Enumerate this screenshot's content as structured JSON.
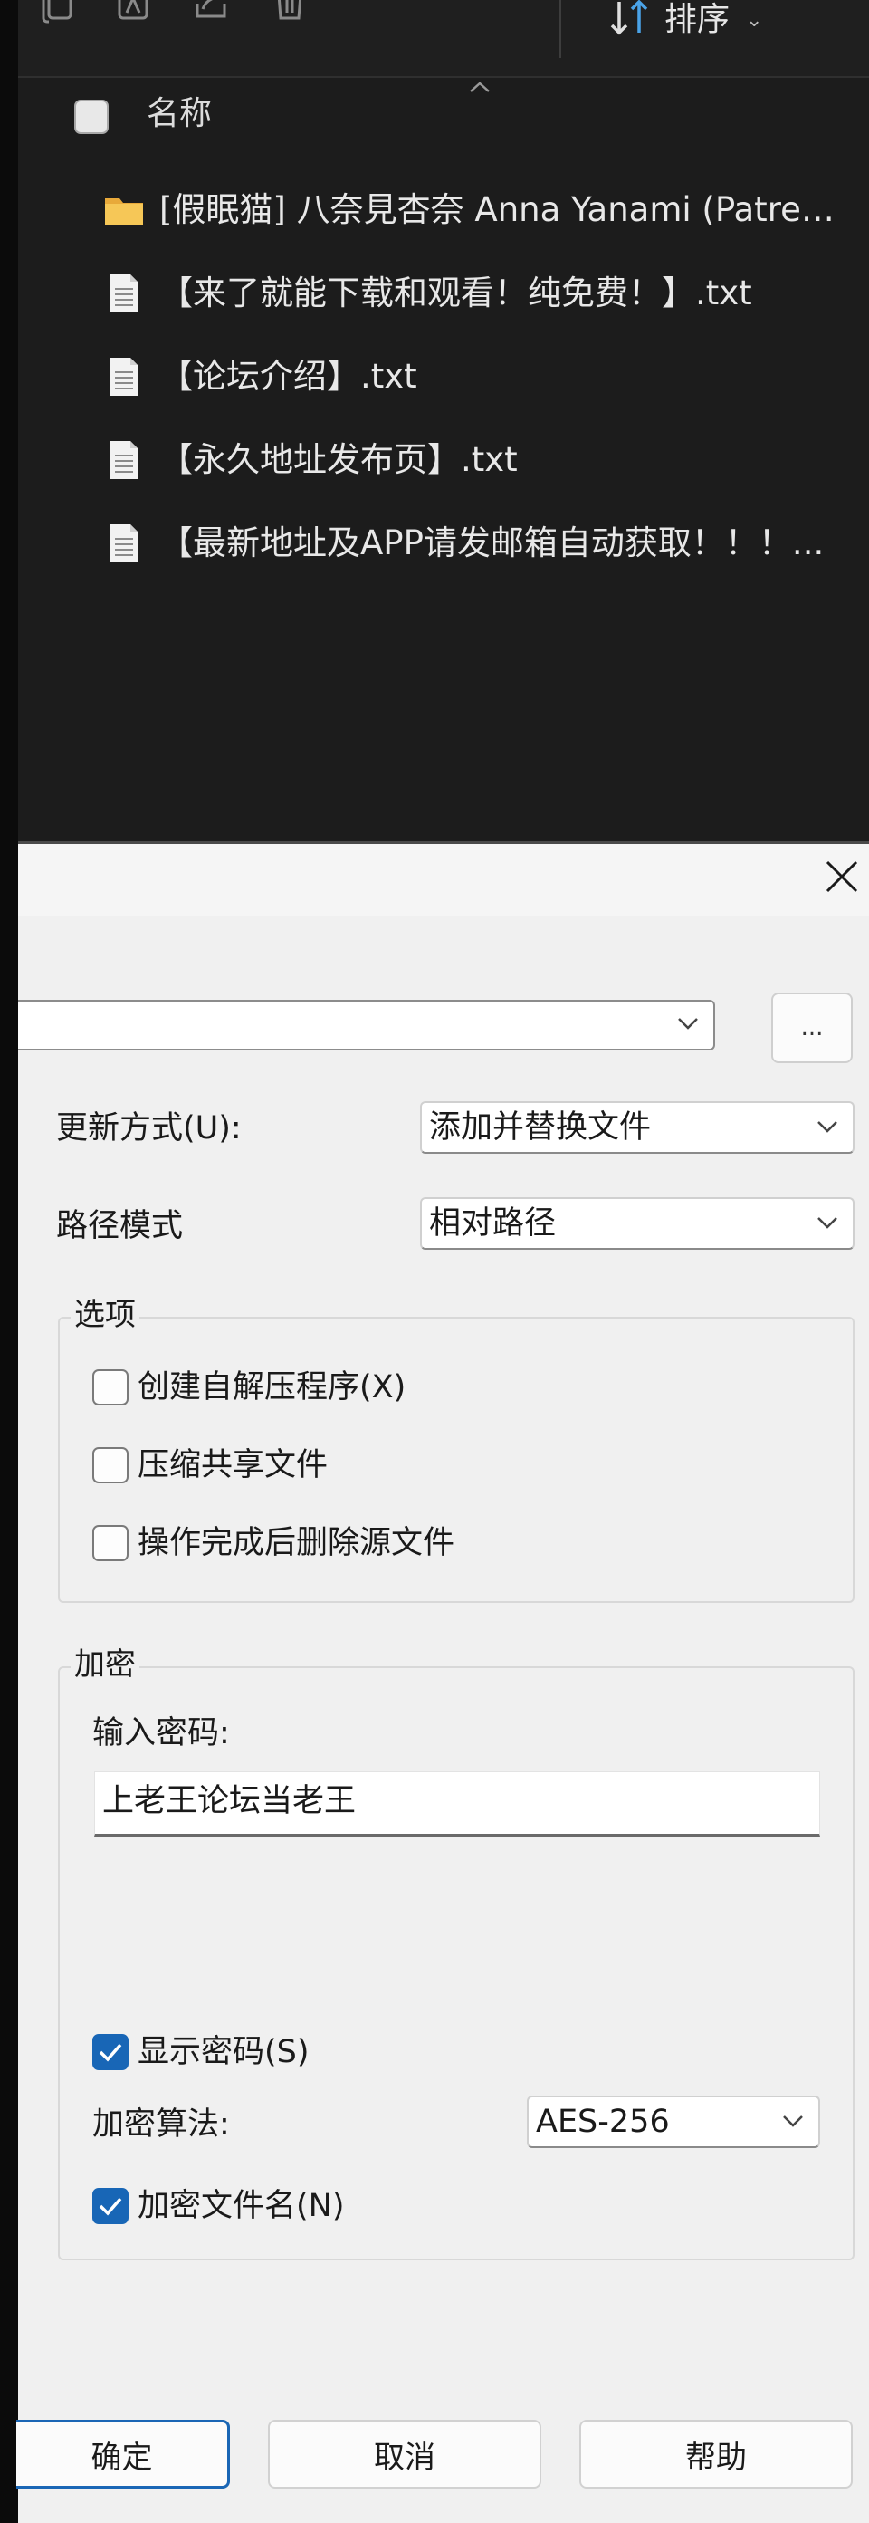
{
  "explorer": {
    "toolbar": {
      "sort_label": "排序"
    },
    "column_header": {
      "name_label": "名称"
    },
    "files": [
      {
        "name": "[假眠猫] 八奈見杏奈 Anna Yanami (Patreo...",
        "type": "folder"
      },
      {
        "name": "【来了就能下载和观看！纯免费！】.txt",
        "type": "text"
      },
      {
        "name": "【论坛介绍】.txt",
        "type": "text"
      },
      {
        "name": "【永久地址发布页】.txt",
        "type": "text"
      },
      {
        "name": "【最新地址及APP请发邮箱自动获取！！！...",
        "type": "text"
      }
    ]
  },
  "dialog": {
    "browse_label": "...",
    "update_mode": {
      "label": "更新方式(U):",
      "value": "添加并替换文件"
    },
    "path_mode": {
      "label": "路径模式",
      "value": "相对路径"
    },
    "options": {
      "title": "选项",
      "sfx": {
        "label": "创建自解压程序(X)",
        "checked": false
      },
      "share": {
        "label": "压缩共享文件",
        "checked": false
      },
      "delete": {
        "label": "操作完成后删除源文件",
        "checked": false
      }
    },
    "encryption": {
      "title": "加密",
      "password_label": "输入密码:",
      "password_value": "上老王论坛当老王",
      "show_password": {
        "label": "显示密码(S)",
        "checked": true
      },
      "method_label": "加密算法:",
      "method_value": "AES-256",
      "encrypt_names": {
        "label": "加密文件名(N)",
        "checked": true
      }
    },
    "buttons": {
      "ok": "确定",
      "cancel": "取消",
      "help": "帮助"
    }
  },
  "colors": {
    "accent": "#1866b6",
    "explorer_bg": "#1c1c1c",
    "folder": "#f2c14e",
    "dialog_bg": "#f0f0f0"
  }
}
